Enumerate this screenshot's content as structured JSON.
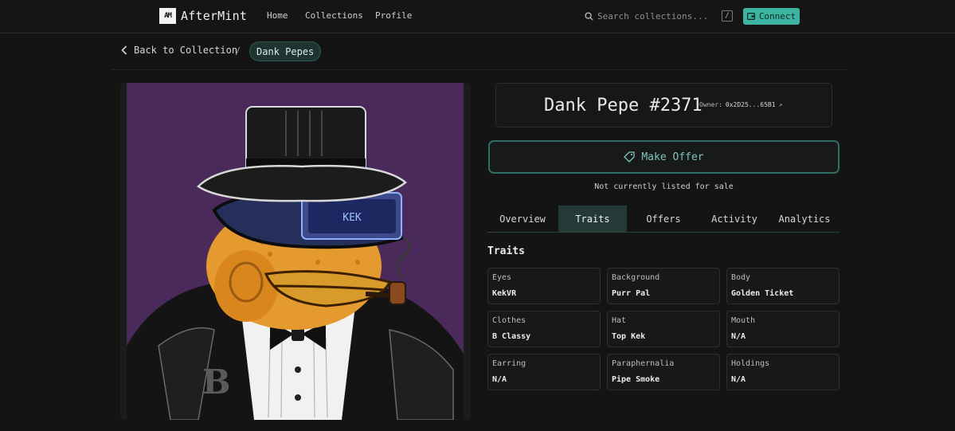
{
  "app": {
    "logo_mark": "AM",
    "name": "AfterMint"
  },
  "nav": {
    "links": [
      "Home",
      "Collections",
      "Profile"
    ],
    "search_placeholder": "Search collections...",
    "search_shortcut": "/",
    "connect_label": "Connect"
  },
  "breadcrumb": {
    "back_label": "Back to Collection",
    "separator": "/",
    "current": "Dank Pepes"
  },
  "nft": {
    "title": "Dank Pepe #2371",
    "owner_label": "Owner:",
    "owner_address": "0x2D25...65B1",
    "artwork_visor_text": "KEK",
    "offer_button": "Make Offer",
    "sale_status": "Not currently listed for sale"
  },
  "tabs": {
    "items": [
      "Overview",
      "Traits",
      "Offers",
      "Activity",
      "Analytics"
    ],
    "active": "Traits"
  },
  "traits": {
    "heading": "Traits",
    "items": [
      {
        "key": "Eyes",
        "value": "KekVR"
      },
      {
        "key": "Background",
        "value": "Purr Pal"
      },
      {
        "key": "Body",
        "value": "Golden Ticket"
      },
      {
        "key": "Clothes",
        "value": "B Classy"
      },
      {
        "key": "Hat",
        "value": "Top Kek"
      },
      {
        "key": "Mouth",
        "value": "N/A"
      },
      {
        "key": "Earring",
        "value": "N/A"
      },
      {
        "key": "Paraphernalia",
        "value": "Pipe Smoke"
      },
      {
        "key": "Holdings",
        "value": "N/A"
      }
    ]
  },
  "colors": {
    "accent": "#3db3a1",
    "background": "#141414",
    "art_background": "#4a2a5a"
  }
}
